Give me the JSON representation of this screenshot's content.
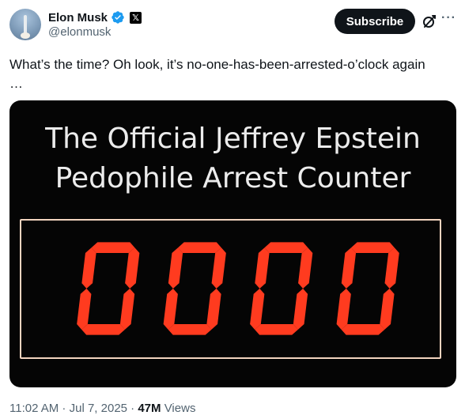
{
  "author": {
    "name": "Elon Musk",
    "handle": "@elonmusk",
    "verified_icon": "verified-badge-icon",
    "affiliation_icon": "x-logo-icon"
  },
  "actions": {
    "subscribe_label": "Subscribe",
    "grok_icon": "grok-icon",
    "more_icon": "more-options-icon",
    "more_glyph": "···"
  },
  "tweet": {
    "text_line1": "What’s the time? Oh look, it’s no-one-has-been-arrested-o’clock again",
    "text_line2": "…"
  },
  "media": {
    "title_line1": "The Official Jeffrey Epstein",
    "title_line2": "Pedophile Arrest Counter",
    "counter_value": "0000",
    "digit_color": "#ff3b1f",
    "frame_color": "#f2d4bf"
  },
  "meta": {
    "time": "11:02 AM",
    "sep1": " · ",
    "date": "Jul 7, 2025",
    "sep2": " · ",
    "views_count": "47M",
    "views_label": " Views"
  },
  "colors": {
    "accent": "#1d9bf0",
    "text_primary": "#0f1419",
    "text_secondary": "#536471"
  }
}
